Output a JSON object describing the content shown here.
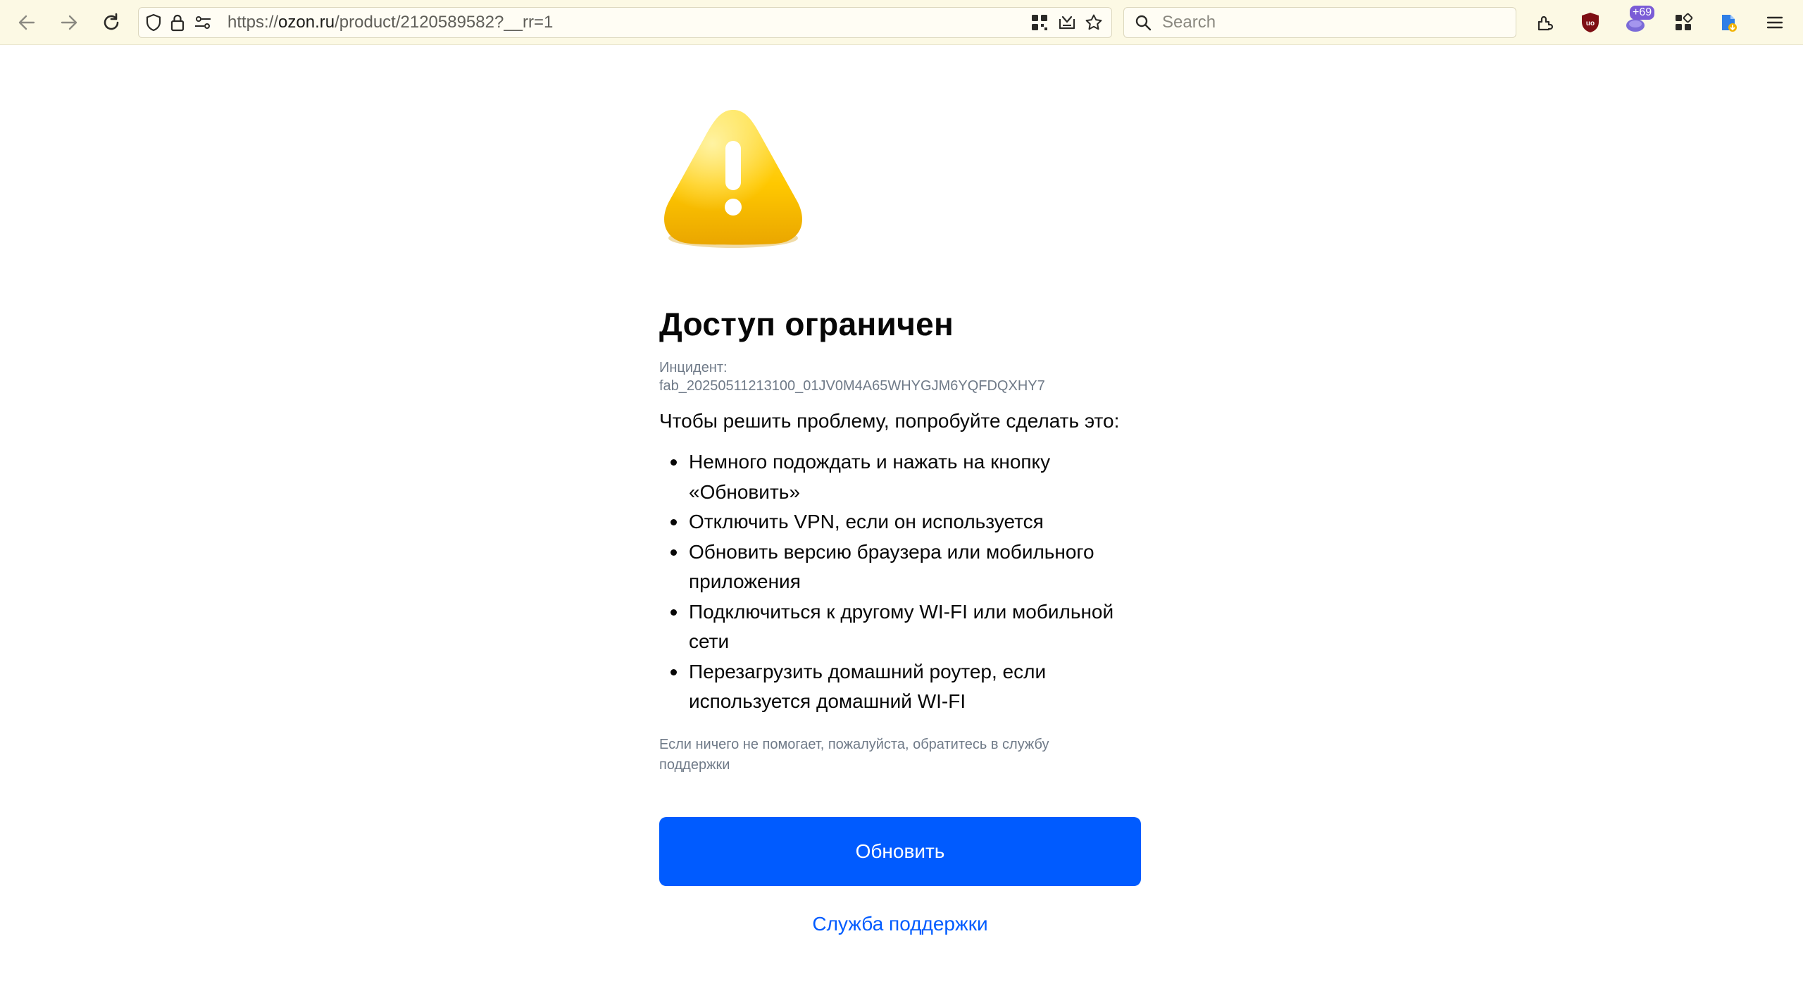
{
  "browser": {
    "url": {
      "scheme": "https://",
      "host": "ozon.ru",
      "path": "/product/2120589582?__rr=1"
    },
    "search_placeholder": "Search",
    "extension_badge": "+69",
    "icons": [
      "back-icon",
      "forward-icon",
      "reload-icon",
      "shield-icon",
      "lock-icon",
      "permissions-icon",
      "qr-icon",
      "reader-view-icon",
      "bookmark-star-icon",
      "search-icon",
      "extensions-icon",
      "ublock-icon",
      "extension-purple-icon",
      "apps-grid-icon",
      "downloads-icon",
      "menu-icon"
    ]
  },
  "page": {
    "icon": "warning-icon",
    "title": "Доступ ограничен",
    "incident_label": "Инцидент:",
    "incident_code": "fab_20250511213100_01JV0M4A65WHYGJM6YQFDQXHY7",
    "intro": "Чтобы решить проблему, попробуйте сделать это:",
    "tips": [
      "Немного подождать и нажать на кнопку «Обновить»",
      "Отключить VPN, если он используется",
      "Обновить версию браузера или мобильного приложения",
      "Подключиться к другому WI-FI или мобильной сети",
      "Перезагрузить домашний роутер, если используется домашний WI-FI"
    ],
    "help_note": "Если ничего не помогает, пожалуйста, обратитесь в службу поддержки",
    "refresh_button": "Обновить",
    "support_link": "Служба поддержки"
  },
  "colors": {
    "toolbar_bg": "#fcf9e4",
    "accent": "#005bff",
    "muted_text": "#6f7a88",
    "warning_yellow": "#ffc800"
  }
}
